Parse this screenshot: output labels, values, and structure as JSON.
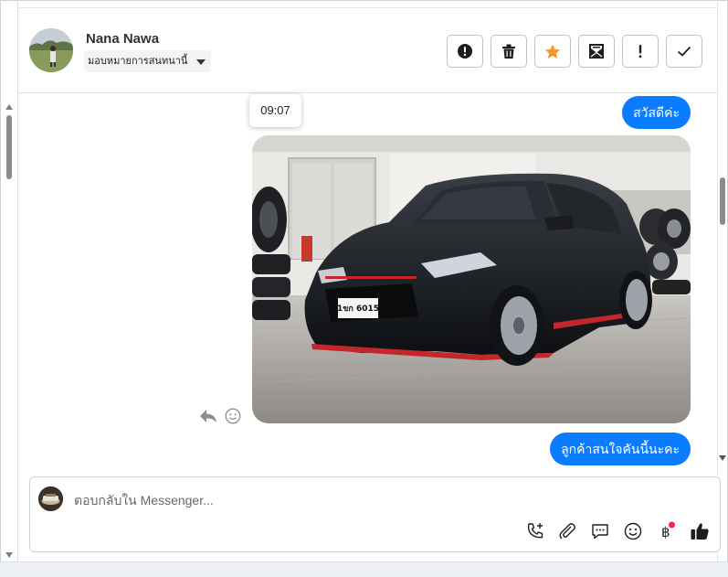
{
  "header": {
    "contact_name": "Nana Nawa",
    "assign_label": "มอบหมายการสนทนานี้",
    "actions": [
      {
        "icon": "alert-circle-icon",
        "name": "mark-spam-button"
      },
      {
        "icon": "trash-icon",
        "name": "delete-button"
      },
      {
        "icon": "star-icon",
        "name": "star-button",
        "color": "#f2962d"
      },
      {
        "icon": "mark-unread-icon",
        "name": "mark-unread-button"
      },
      {
        "icon": "exclamation-icon",
        "name": "follow-up-button"
      },
      {
        "icon": "check-icon",
        "name": "mark-done-button"
      }
    ]
  },
  "messages": {
    "tooltip_time": "09:07",
    "items": [
      {
        "type": "text",
        "direction": "outgoing",
        "text": "สวัสดีค่ะ"
      },
      {
        "type": "image",
        "direction": "outgoing",
        "alt": "black hatchback car"
      },
      {
        "type": "text",
        "direction": "outgoing",
        "text": "ลูกค้าสนใจคันนี้นะคะ"
      }
    ],
    "car_plate": "1ขก 6015"
  },
  "composer": {
    "placeholder": "ตอบกลับใน Messenger...",
    "tools": [
      "call-plus-icon",
      "attachment-icon",
      "chat-bubble-icon",
      "emoji-icon",
      "baht-icon",
      "thumbs-up-icon"
    ]
  },
  "colors": {
    "accent": "#0a7cff",
    "star": "#f2962d",
    "badge": "#f02849"
  }
}
